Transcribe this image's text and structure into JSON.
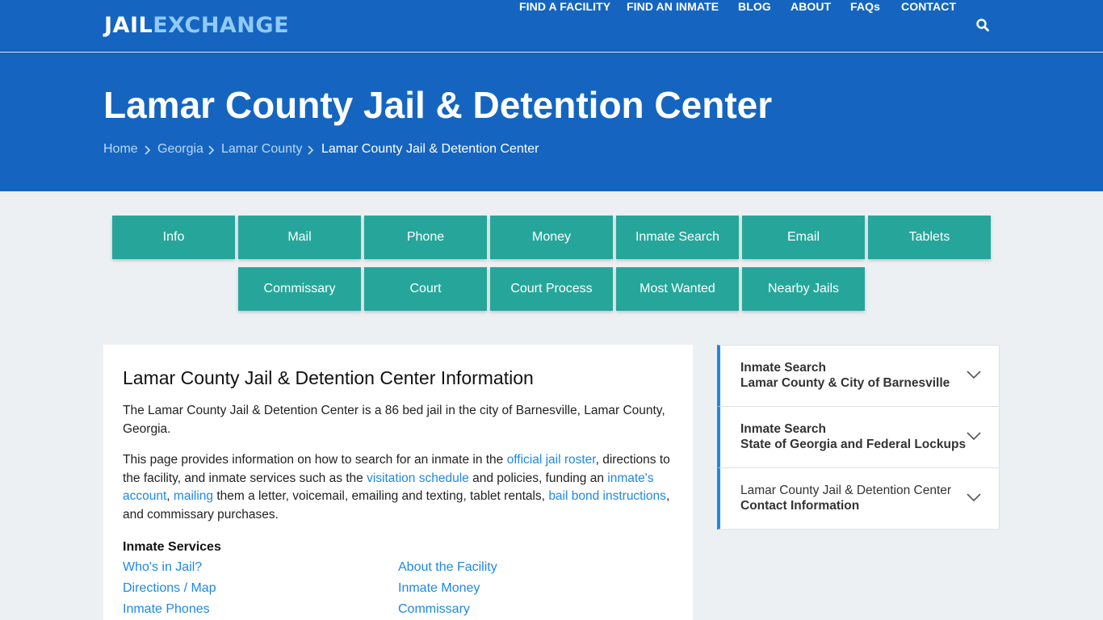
{
  "header": {
    "logo_part1": "JAIL",
    "logo_part2": "EXCHANGE",
    "nav": [
      "FIND A FACILITY",
      "FIND AN INMATE",
      "BLOG",
      "ABOUT",
      "FAQs",
      "CONTACT"
    ],
    "search_icon": "search-icon"
  },
  "hero": {
    "title": "Lamar County Jail & Detention Center",
    "breadcrumbs": [
      "Home",
      "Georgia",
      "Lamar County",
      "Lamar County Jail & Detention Center"
    ]
  },
  "tabs_row1": [
    "Info",
    "Mail",
    "Phone",
    "Money",
    "Inmate Search",
    "Email",
    "Tablets"
  ],
  "tabs_row2": [
    "Commissary",
    "Court",
    "Court Process",
    "Most Wanted",
    "Nearby Jails"
  ],
  "main": {
    "heading": "Lamar County Jail & Detention Center Information",
    "para1": "The Lamar County Jail & Detention Center is a 86 bed jail in the city of Barnesville, Lamar County, Georgia.",
    "para2": {
      "t1": "This page provides information on how to search for an inmate in the ",
      "l1": "official jail roster",
      "t2": ", directions to the facility, and inmate services such as the ",
      "l2": "visitation schedule",
      "t3": " and policies, funding an ",
      "l3": "inmate's account",
      "t4": ", ",
      "l4": "mailing",
      "t5": " them a letter, voicemail, emailing and texting, tablet rentals, ",
      "l5": "bail bond instructions",
      "t6": ", and commissary purchases."
    },
    "services_title": "Inmate Services",
    "services_left": [
      "Who's in Jail?",
      "Directions / Map",
      "Inmate Phones"
    ],
    "services_right": [
      "About the Facility",
      "Inmate Money",
      "Commissary"
    ]
  },
  "sidebar": [
    {
      "line1": "Inmate Search",
      "line2": "Lamar County & City of Barnesville"
    },
    {
      "line1": "Inmate Search",
      "line2": "State of Georgia and Federal Lockups"
    },
    {
      "line1": "Lamar County Jail & Detention Center",
      "line2": "Contact Information"
    }
  ],
  "colors": {
    "header_blue": "#1565c0",
    "button_teal": "#26a69a",
    "link_blue": "#1e88e5",
    "page_bg": "#edf0f3"
  }
}
